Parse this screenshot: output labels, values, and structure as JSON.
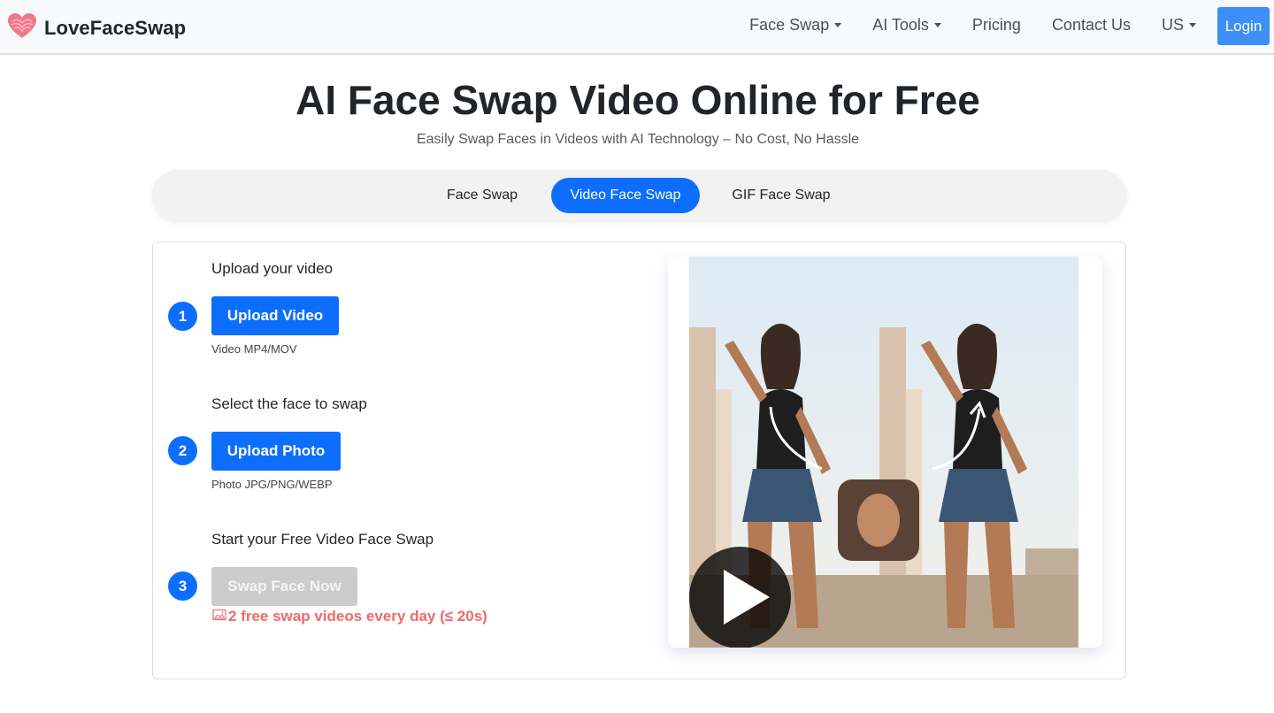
{
  "header": {
    "brand": "LoveFaceSwap",
    "nav": [
      {
        "label": "Face Swap",
        "dropdown": true
      },
      {
        "label": "AI Tools",
        "dropdown": true
      },
      {
        "label": "Pricing",
        "dropdown": false
      },
      {
        "label": "Contact Us",
        "dropdown": false
      },
      {
        "label": "US",
        "dropdown": true
      }
    ],
    "login_label": "Login"
  },
  "hero": {
    "title": "AI Face Swap Video Online for Free",
    "subtitle": "Easily Swap Faces in Videos with AI Technology – No Cost, No Hassle"
  },
  "tabs": [
    {
      "label": "Face Swap",
      "active": false
    },
    {
      "label": "Video Face Swap",
      "active": true
    },
    {
      "label": "GIF Face Swap",
      "active": false
    }
  ],
  "steps": [
    {
      "number": "1",
      "title": "Upload your video",
      "button": "Upload Video",
      "hint": "Video MP4/MOV"
    },
    {
      "number": "2",
      "title": "Select the face to swap",
      "button": "Upload Photo",
      "hint": "Photo JPG/PNG/WEBP"
    },
    {
      "number": "3",
      "title": "Start your Free Video Face Swap",
      "button": "Swap Face Now",
      "note": "2 free swap videos every day (≤ 20s)"
    }
  ],
  "colors": {
    "primary": "#0d6efd",
    "login": "#3e8ef7",
    "note_red": "#ee6a6a",
    "disabled": "#cccccc",
    "brand_heart": "#f0788c"
  },
  "icons": {
    "brand": "heart-logo-icon",
    "note": "image-icon",
    "preview": "play-icon"
  }
}
